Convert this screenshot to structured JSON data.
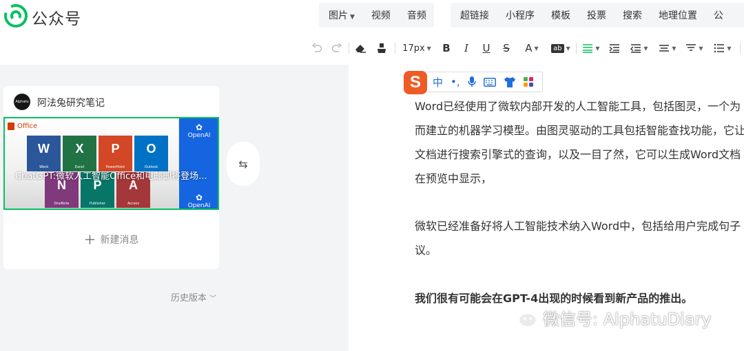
{
  "brand": {
    "name": "公众号"
  },
  "insert_menu": {
    "group1": [
      {
        "label": "图片",
        "has_dropdown": true
      },
      {
        "label": "视频"
      },
      {
        "label": "音频"
      }
    ],
    "group2": [
      {
        "label": "超链接"
      },
      {
        "label": "小程序"
      },
      {
        "label": "模板"
      },
      {
        "label": "投票"
      },
      {
        "label": "搜索"
      },
      {
        "label": "地理位置"
      },
      {
        "label": "公"
      }
    ]
  },
  "toolbar": {
    "font_size": "17px",
    "highlight_label": "ab"
  },
  "account": {
    "avatar_text": "Alphatu",
    "name": "阿法兔研究笔记"
  },
  "article": {
    "title": "ChatGPT:微软人工智能Office和电邮即将登场...",
    "office_label": "Office",
    "openai_label": "OpenAI",
    "apps": [
      {
        "name": "Word",
        "letter": "W",
        "color": "#2b579a"
      },
      {
        "name": "Excel",
        "letter": "X",
        "color": "#217346"
      },
      {
        "name": "PowerPoint",
        "letter": "P",
        "color": "#d24726"
      },
      {
        "name": "Outlook",
        "letter": "O",
        "color": "#0072c6"
      },
      {
        "name": "OneNote",
        "letter": "N",
        "color": "#80397b"
      },
      {
        "name": "Publisher",
        "letter": "P",
        "color": "#077568"
      },
      {
        "name": "Access",
        "letter": "A",
        "color": "#a4373a"
      }
    ]
  },
  "new_message": "新建消息",
  "history": "历史版本",
  "editor": {
    "lines": [
      "Word已经使用了微软内部开发的人工智能工具，包括图灵，一个为",
      "而建立的机器学习模型。由图灵驱动的工具包括智能查找功能，它让",
      "文档进行搜索引擎式的查询，以及一目了然，它可以生成Word文档",
      "在预览中显示，",
      "微软已经准备好将人工智能技术纳入Word中，包括给用户完成句子",
      "议。",
      "我们很有可能会在GPT-4出现的时候看到新产品的推出。"
    ]
  },
  "ime": {
    "logo": "S",
    "mode": "中",
    "punct": "•,"
  },
  "watermark": {
    "text": "微信号: AlphatuDiary"
  },
  "colors": {
    "accent": "#07c160",
    "openai_blue": "#1565e0",
    "ime_orange": "#ef5b25"
  }
}
